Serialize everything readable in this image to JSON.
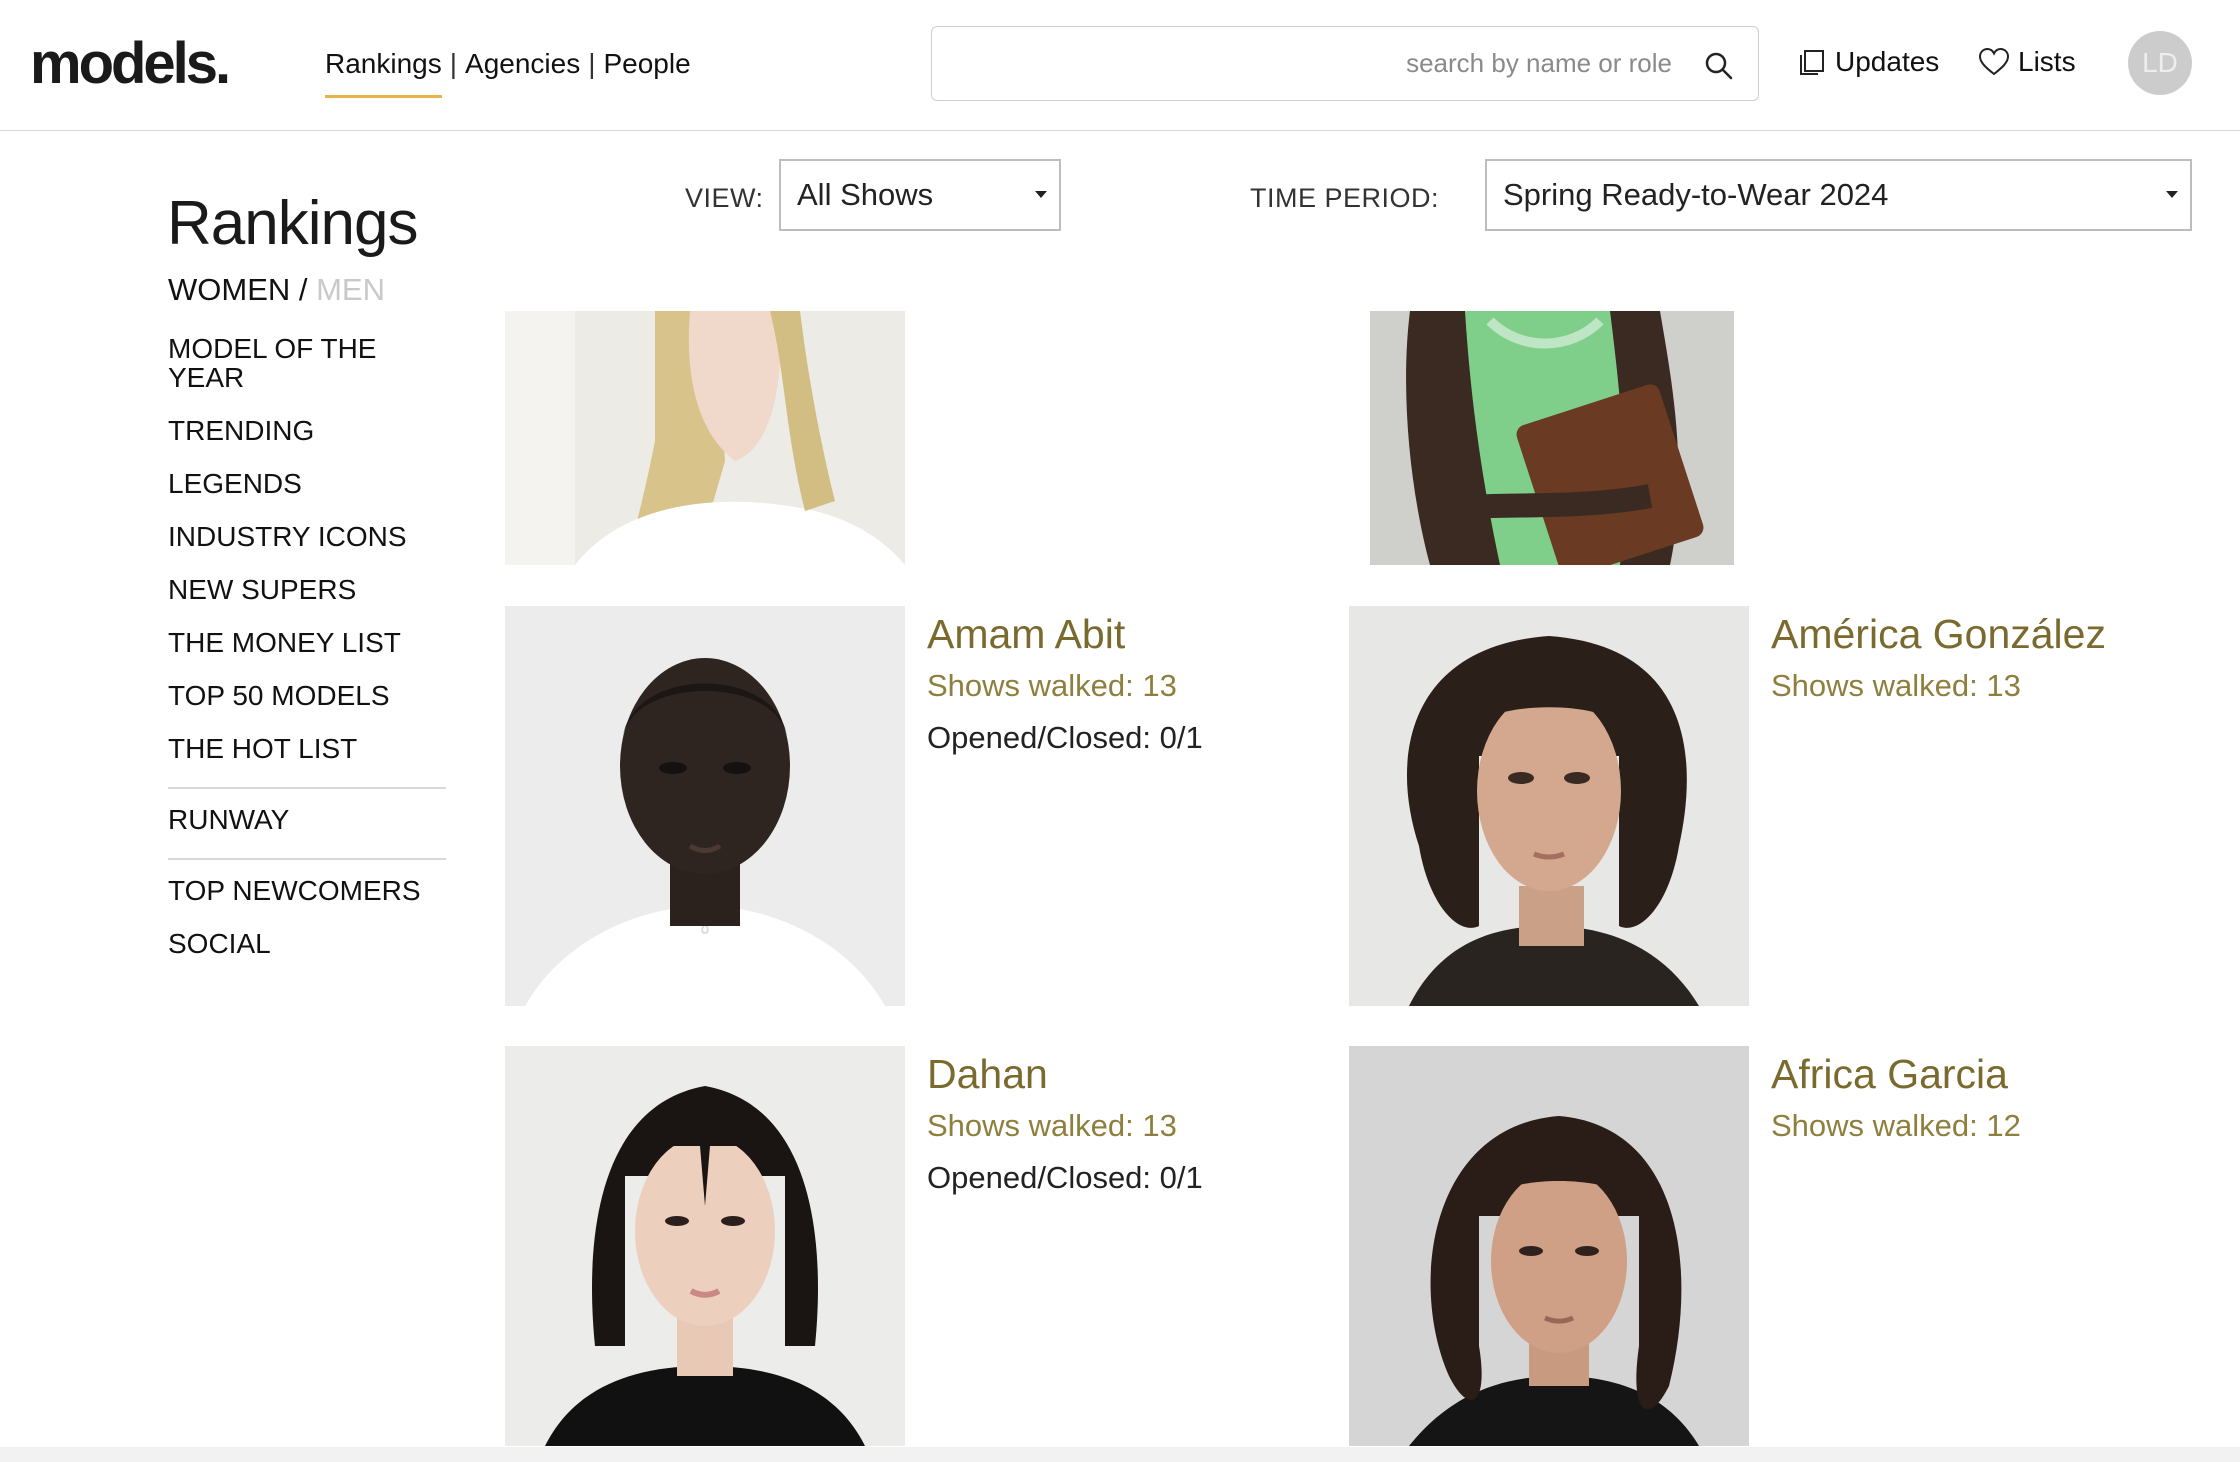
{
  "header": {
    "logo": "models.",
    "nav": [
      "Rankings",
      "Agencies",
      "People"
    ],
    "nav_separator": "|",
    "search_placeholder": "search by name or role",
    "updates_label": "Updates",
    "lists_label": "Lists",
    "avatar_initials": "LD"
  },
  "sidebar": {
    "title": "Rankings",
    "gender_women": "WOMEN",
    "gender_sep": " / ",
    "gender_men": "MEN",
    "items": [
      "MODEL OF THE YEAR",
      "TRENDING",
      "LEGENDS",
      "INDUSTRY ICONS",
      "NEW SUPERS",
      "THE MONEY LIST",
      "TOP 50 MODELS",
      "THE HOT LIST",
      "RUNWAY",
      "TOP NEWCOMERS",
      "SOCIAL"
    ]
  },
  "filters": {
    "view_label": "VIEW:",
    "view_value": "All Shows",
    "time_label": "TIME PERIOD:",
    "time_value": "Spring Ready-to-Wear 2024"
  },
  "models": [
    {
      "name": "Amam Abit",
      "shows": "Shows walked: 13",
      "opened_closed": "Opened/Closed: 0/1"
    },
    {
      "name": "América González",
      "shows": "Shows walked: 13",
      "opened_closed": ""
    },
    {
      "name": "Dahan",
      "shows": "Shows walked: 13",
      "opened_closed": "Opened/Closed: 0/1"
    },
    {
      "name": "Africa Garcia",
      "shows": "Shows walked: 12",
      "opened_closed": ""
    }
  ],
  "colors": {
    "accent_underline": "#e6b34a",
    "name_gold": "#7a6a2e",
    "shows_gold": "#8f7f3e",
    "avatar_gray": "#cccccc"
  }
}
